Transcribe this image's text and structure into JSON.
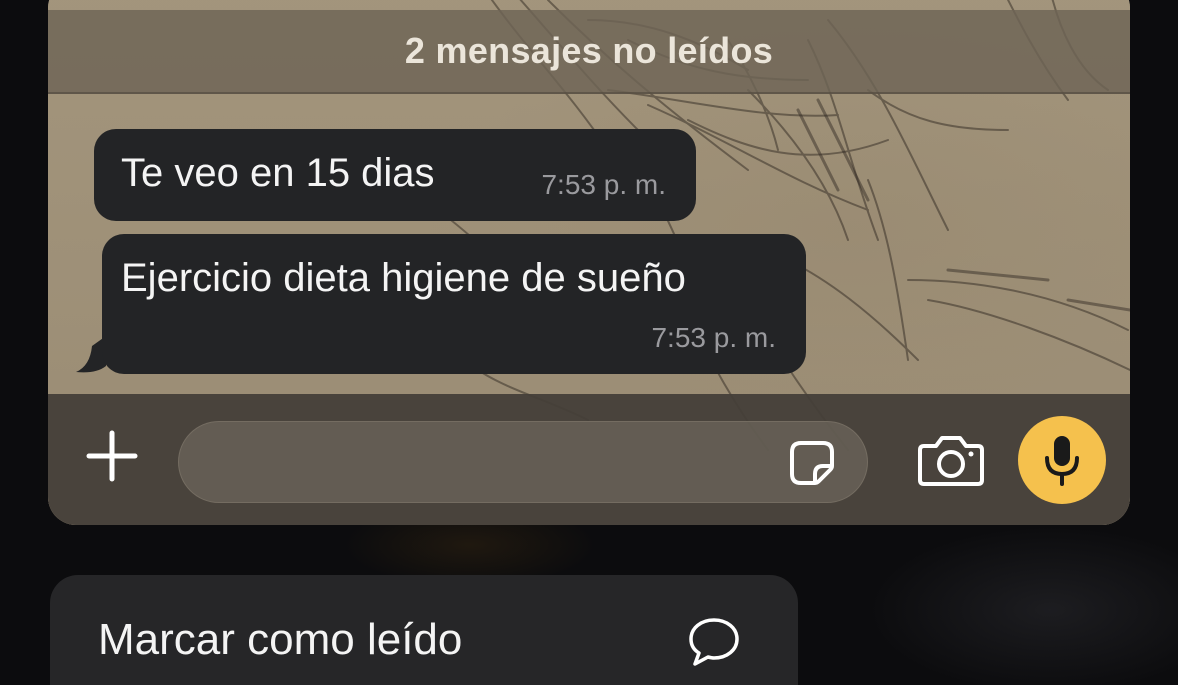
{
  "banner": {
    "unread_text": "2 mensajes no leídos"
  },
  "messages": [
    {
      "text": "Te veo en 15 dias",
      "time": "7:53 p. m."
    },
    {
      "text": "Ejercicio dieta higiene de sueño",
      "time": "7:53 p. m."
    }
  ],
  "composer": {
    "value": "",
    "placeholder": "",
    "plus_icon": "plus-icon",
    "sticker_icon": "sticker-icon",
    "camera_icon": "camera-icon",
    "mic_icon": "microphone-icon",
    "mic_color": "#f5c14d"
  },
  "context_menu": {
    "items": [
      {
        "label": "Marcar como leído",
        "icon": "chat-bubble-icon"
      }
    ]
  },
  "colors": {
    "bubble": "#232426",
    "accent": "#f5c14d",
    "menu_bg": "#262628"
  }
}
